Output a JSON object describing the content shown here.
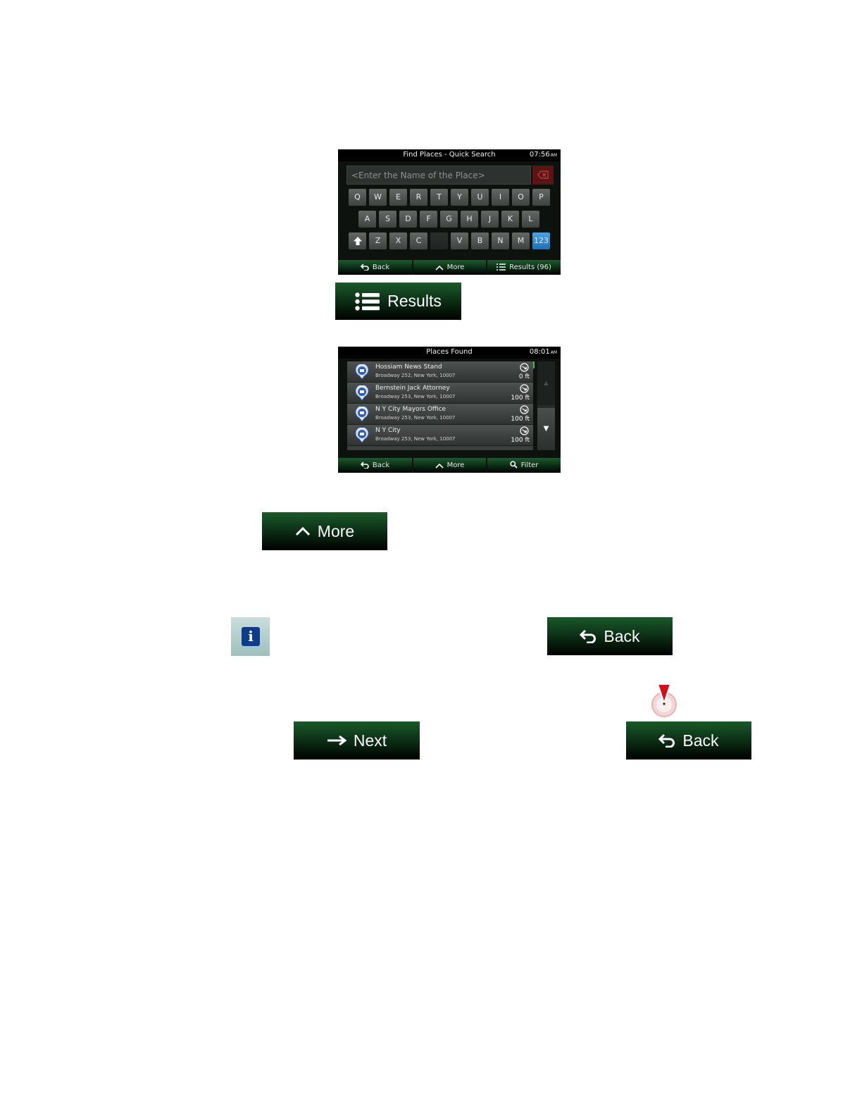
{
  "keyboard_screen": {
    "title": "Find Places - Quick Search",
    "time": "07:56",
    "ampm": "AM",
    "search_placeholder": "<Enter the Name of the Place>",
    "keys_row1": [
      "Q",
      "W",
      "E",
      "R",
      "T",
      "Y",
      "U",
      "I",
      "O",
      "P"
    ],
    "keys_row2": [
      "A",
      "S",
      "D",
      "F",
      "G",
      "H",
      "J",
      "K",
      "L"
    ],
    "keys_row3": [
      "Z",
      "X",
      "C",
      "",
      "V",
      "B",
      "N",
      "M"
    ],
    "numeric_key": "123",
    "back_label": "Back",
    "more_label": "More",
    "results_label": "Results (96)"
  },
  "results_button": {
    "label": "Results"
  },
  "list_screen": {
    "title": "Places Found",
    "time": "08:01",
    "ampm": "AM",
    "items": [
      {
        "name": "Hossiam News Stand",
        "address": "Broadway 252, New York, 10007",
        "distance": "0 ft",
        "icon": "shopping-cart-icon"
      },
      {
        "name": "Bernstein Jack Attorney",
        "address": "Broadway 253, New York, 10007",
        "distance": "100 ft",
        "icon": "briefcase-icon"
      },
      {
        "name": "N Y City Mayors Office",
        "address": "Broadway 253, New York, 10007",
        "distance": "100 ft",
        "icon": "government-icon"
      },
      {
        "name": "N Y City",
        "address": "Broadway 253, New York, 10007",
        "distance": "100 ft",
        "icon": "government-icon"
      }
    ],
    "back_label": "Back",
    "more_label": "More",
    "filter_label": "Filter"
  },
  "more_button": {
    "label": "More"
  },
  "back_button_1": {
    "label": "Back"
  },
  "next_button": {
    "label": "Next"
  },
  "back_button_2": {
    "label": "Back"
  },
  "colors": {
    "button_green": "#1a5a2a",
    "screen_bg": "#0d120f",
    "accent_blue": "#1f6fb8"
  }
}
